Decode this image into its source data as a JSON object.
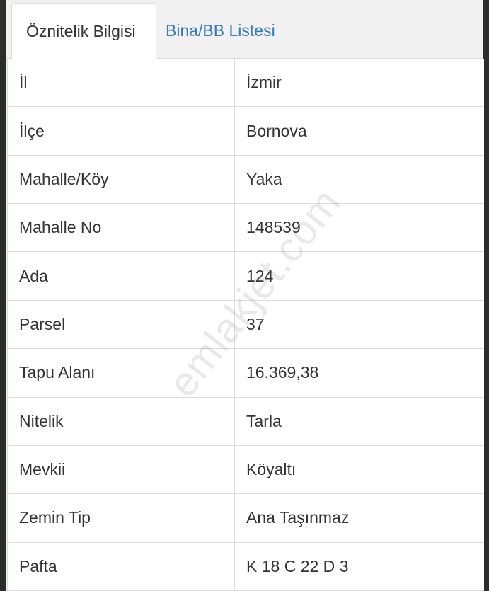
{
  "tabs": [
    {
      "label": "Öznitelik Bilgisi",
      "active": true
    },
    {
      "label": "Bina/BB Listesi",
      "active": false
    }
  ],
  "rows": [
    {
      "key": "İl",
      "value": "İzmir"
    },
    {
      "key": "İlçe",
      "value": "Bornova"
    },
    {
      "key": "Mahalle/Köy",
      "value": "Yaka"
    },
    {
      "key": "Mahalle No",
      "value": "148539"
    },
    {
      "key": "Ada",
      "value": "124"
    },
    {
      "key": "Parsel",
      "value": "37"
    },
    {
      "key": "Tapu Alanı",
      "value": "16.369,38"
    },
    {
      "key": "Nitelik",
      "value": "Tarla"
    },
    {
      "key": "Mevkii",
      "value": "Köyaltı"
    },
    {
      "key": "Zemin Tip",
      "value": "Ana Taşınmaz"
    },
    {
      "key": "Pafta",
      "value": "K 18 C 22 D 3"
    }
  ],
  "watermark": "emlakjet.com",
  "colors": {
    "tab_link": "#3a7ab8",
    "text": "#333333",
    "border": "#dcdcdc",
    "panel_bg": "#f1f1f1"
  }
}
